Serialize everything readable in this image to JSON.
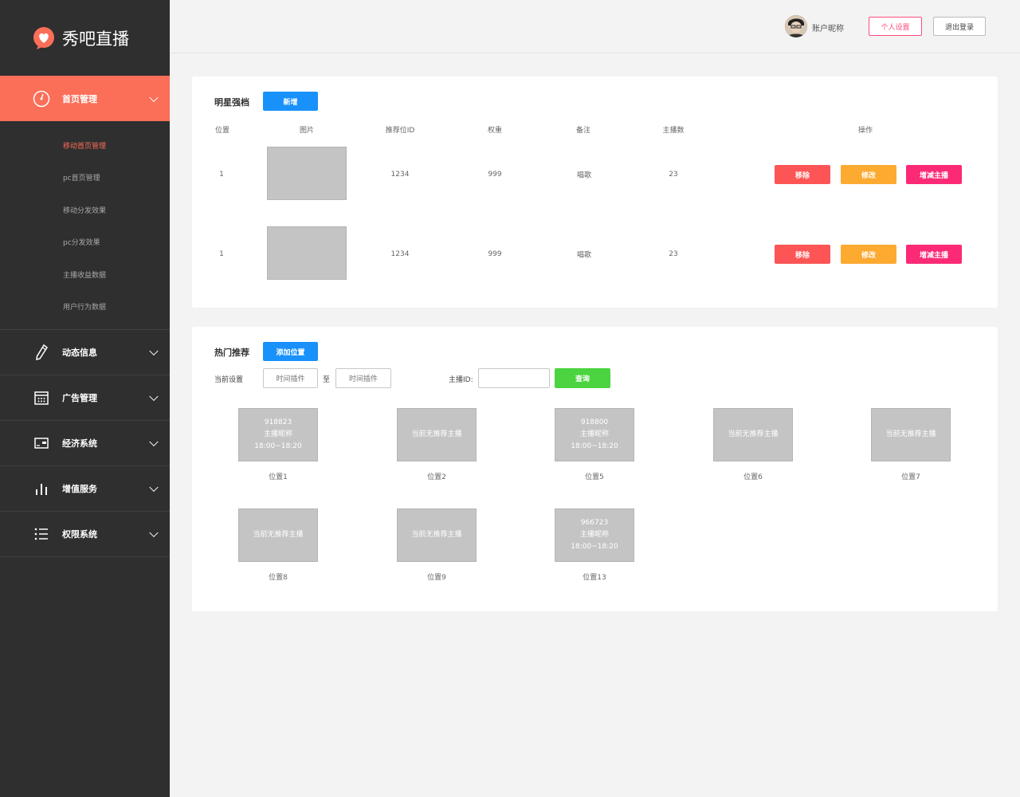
{
  "brand": {
    "name": "秀吧直播",
    "accent": "#fb6e58"
  },
  "sidebar": {
    "groups": [
      {
        "label": "首页管理",
        "icon": "gauge-icon",
        "active": true
      },
      {
        "label": "动态信息",
        "icon": "pencil-icon"
      },
      {
        "label": "广告管理",
        "icon": "calendar-icon"
      },
      {
        "label": "经济系统",
        "icon": "wallet-icon"
      },
      {
        "label": "增值服务",
        "icon": "bar-chart-icon"
      },
      {
        "label": "权限系统",
        "icon": "list-icon"
      }
    ],
    "sub_items": [
      {
        "label": "移动首页管理",
        "active": true
      },
      {
        "label": "pc首页管理"
      },
      {
        "label": "移动分发效果"
      },
      {
        "label": "pc分发效果"
      },
      {
        "label": "主播收益数据"
      },
      {
        "label": "用户行为数据"
      }
    ]
  },
  "header": {
    "username": "账户昵称",
    "profile_button": "个人设置",
    "logout_button": "退出登录"
  },
  "star": {
    "title": "明星强档",
    "add_button": "新增",
    "columns": [
      "位置",
      "图片",
      "推荐位ID",
      "权重",
      "备注",
      "主播数",
      "操作"
    ],
    "rows": [
      {
        "position": "1",
        "id": "1234",
        "weight": "999",
        "note": "唱歌",
        "count": "23"
      },
      {
        "position": "1",
        "id": "1234",
        "weight": "999",
        "note": "唱歌",
        "count": "23"
      }
    ],
    "actions": {
      "remove": "移除",
      "edit": "修改",
      "manage": "增减主播"
    }
  },
  "hot": {
    "title": "热门推荐",
    "add_button": "添加位置",
    "current_label": "当前设置",
    "time_start_placeholder": "时间插件",
    "to_label": "至",
    "time_end_placeholder": "时间插件",
    "anchor_id_label": "主播ID:",
    "anchor_id_value": "",
    "query_button": "查询",
    "slots": [
      {
        "lines": [
          "918823",
          "主播昵称",
          "18:00~18:20"
        ],
        "caption": "位置1"
      },
      {
        "lines": [
          "当前无推荐主播"
        ],
        "caption": "位置2"
      },
      {
        "lines": [
          "918800",
          "主播昵称",
          "18:00~18:20"
        ],
        "caption": "位置5"
      },
      {
        "lines": [
          "当前无推荐主播"
        ],
        "caption": "位置6"
      },
      {
        "lines": [
          "当前无推荐主播"
        ],
        "caption": "位置7"
      },
      {
        "lines": [
          "当前无推荐主播"
        ],
        "caption": "位置8"
      },
      {
        "lines": [
          "当前无推荐主播"
        ],
        "caption": "位置9"
      },
      {
        "lines": [
          "966723",
          "主播昵称",
          "18:00~18:20"
        ],
        "caption": "位置13"
      }
    ]
  }
}
